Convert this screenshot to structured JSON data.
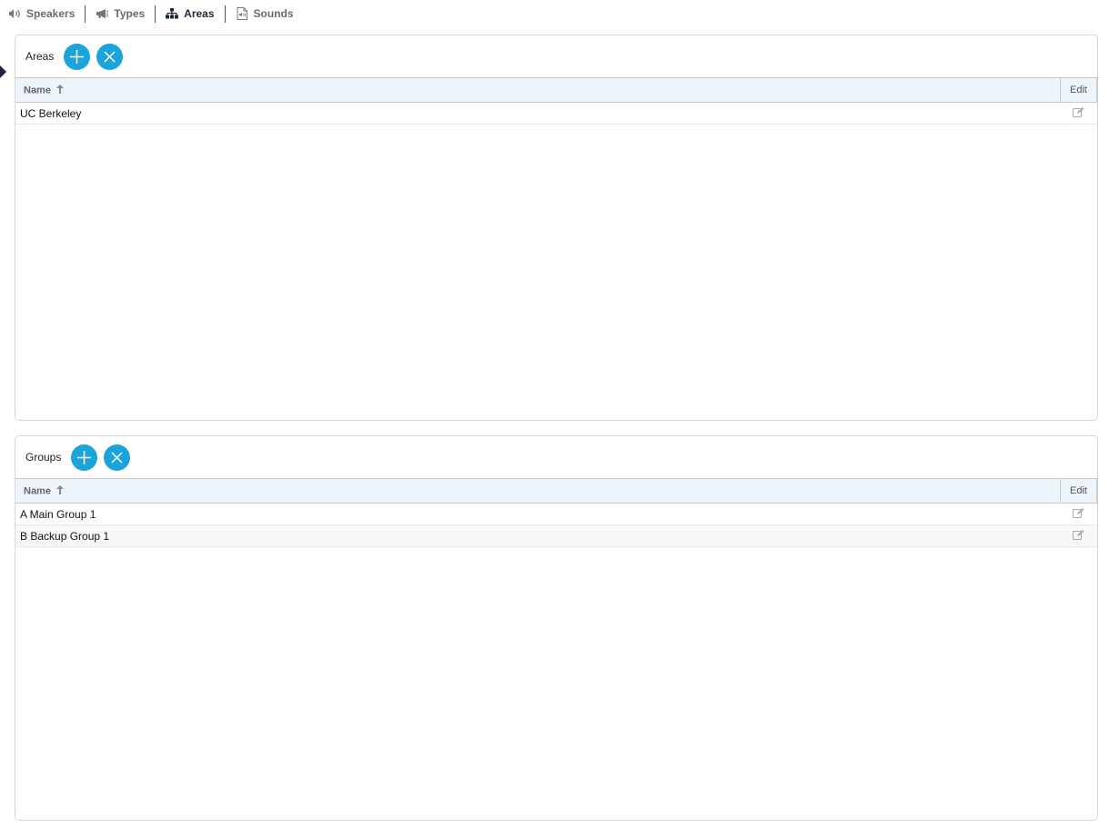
{
  "nav": {
    "items": [
      {
        "label": "Speakers",
        "icon": "speaker-icon",
        "active": false
      },
      {
        "label": "Types",
        "icon": "megaphone-icon",
        "active": false
      },
      {
        "label": "Areas",
        "icon": "sitemap-icon",
        "active": true
      },
      {
        "label": "Sounds",
        "icon": "sound-file-icon",
        "active": false
      }
    ]
  },
  "colors": {
    "accent": "#1ba3dc",
    "header_bg": "#eef4fb",
    "active_nav": "#1c2b3c"
  },
  "areas": {
    "title": "Areas",
    "add_icon": "plus-icon",
    "remove_icon": "close-icon",
    "columns": {
      "name": "Name",
      "edit": "Edit"
    },
    "sort_icon": "sort-up-icon",
    "rows": [
      {
        "name": "UC Berkeley"
      }
    ]
  },
  "groups": {
    "title": "Groups",
    "add_icon": "plus-icon",
    "remove_icon": "close-icon",
    "columns": {
      "name": "Name",
      "edit": "Edit"
    },
    "sort_icon": "sort-up-icon",
    "rows": [
      {
        "name": "A Main Group 1"
      },
      {
        "name": "B Backup Group 1"
      }
    ]
  }
}
